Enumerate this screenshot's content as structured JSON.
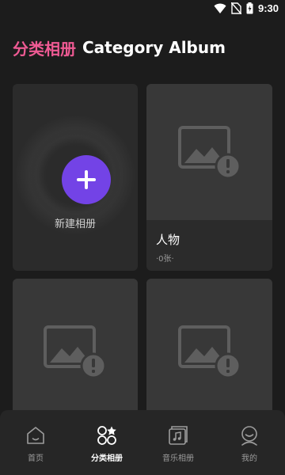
{
  "status_bar": {
    "time": "9:30",
    "icons": [
      "wifi-icon",
      "no-sim-icon",
      "battery-icon"
    ]
  },
  "header": {
    "title_cn": "分类相册",
    "title_en": "Category Album",
    "title_cn_color": "#ee5a93"
  },
  "new_album": {
    "label": "新建相册",
    "button_color": "#7343e6"
  },
  "albums": [
    {
      "name": "人物",
      "count": "·0张·",
      "icon": "image-error-icon"
    },
    {
      "name": "",
      "count": "",
      "icon": "image-error-icon"
    },
    {
      "name": "",
      "count": "",
      "icon": "image-error-icon"
    }
  ],
  "tabs": [
    {
      "label": "首页",
      "icon": "home-icon",
      "active": false
    },
    {
      "label": "分类相册",
      "icon": "category-icon",
      "active": true
    },
    {
      "label": "音乐相册",
      "icon": "music-album-icon",
      "active": false
    },
    {
      "label": "我的",
      "icon": "profile-icon",
      "active": false
    }
  ]
}
